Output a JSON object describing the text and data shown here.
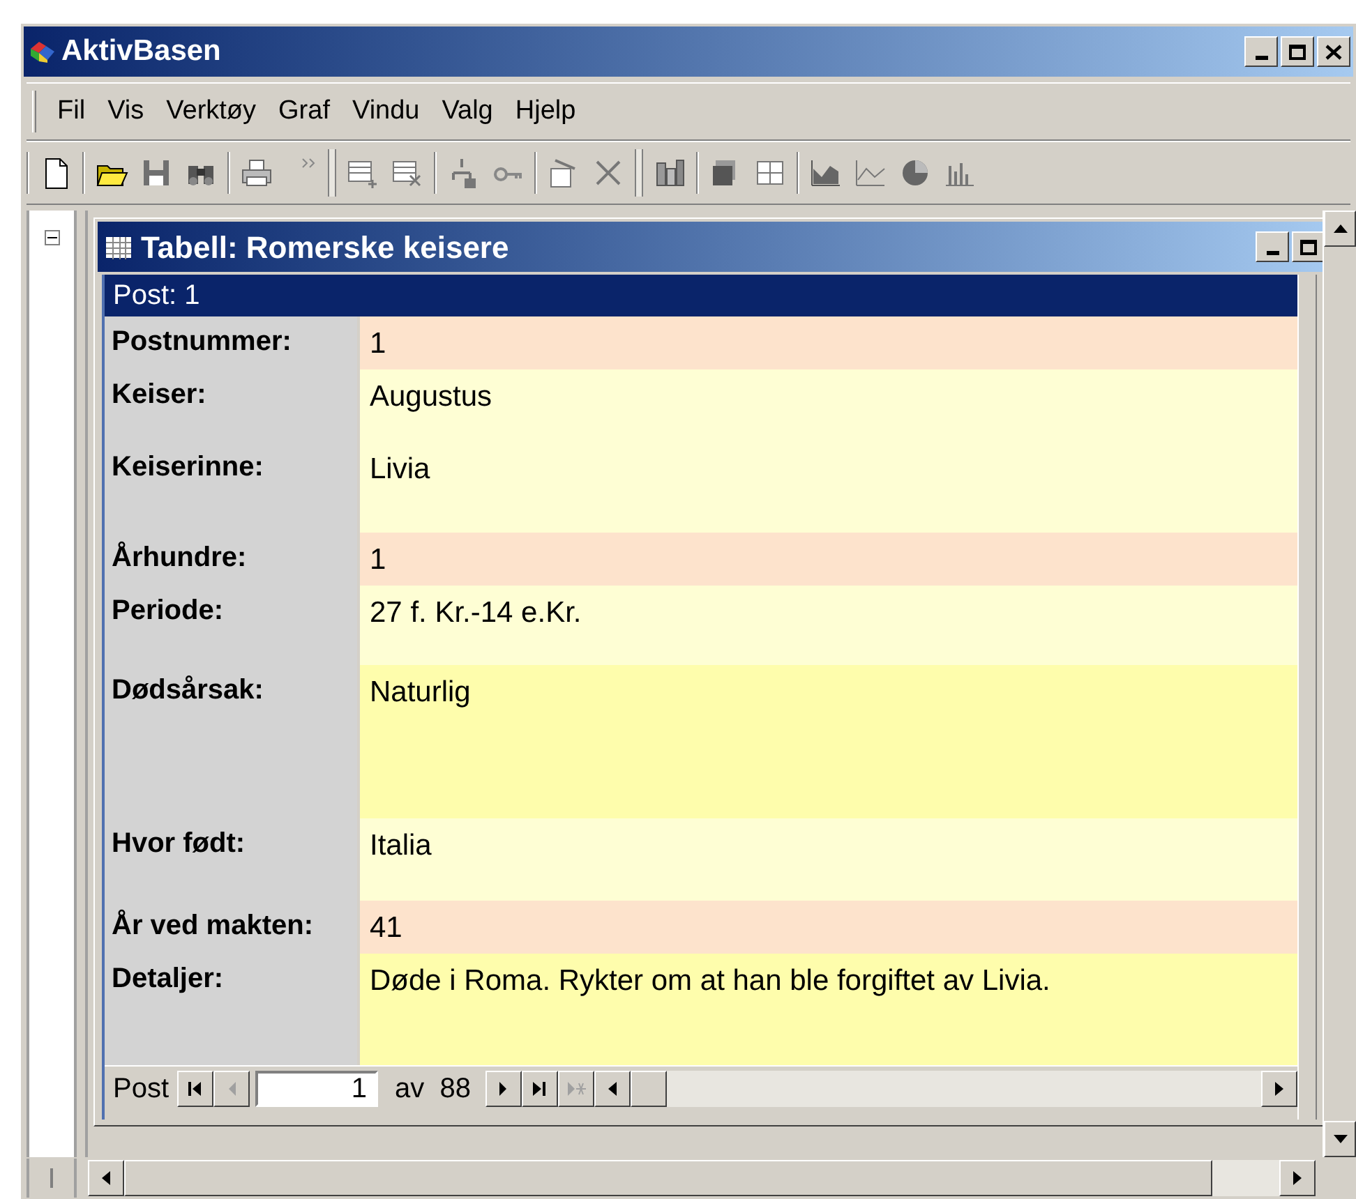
{
  "window": {
    "title": "AktivBasen"
  },
  "menu": [
    "Fil",
    "Vis",
    "Verktøy",
    "Graf",
    "Vindu",
    "Valg",
    "Hjelp"
  ],
  "child_window": {
    "title": "Tabell: Romerske keisere"
  },
  "record_header": "Post: 1",
  "fields": [
    {
      "label": "Postnummer:",
      "value": "1",
      "color": "#fde3cc"
    },
    {
      "label": "Keiser:",
      "value": "Augustus",
      "color": "#fefed4"
    },
    {
      "label": "Keiserinne:",
      "value": "Livia",
      "color": "#fefed4"
    },
    {
      "label": "Århundre:",
      "value": "1",
      "color": "#fde3cc"
    },
    {
      "label": "Periode:",
      "value": "27 f. Kr.-14 e.Kr.",
      "color": "#fefed4"
    },
    {
      "label": "Dødsårsak:",
      "value": "Naturlig",
      "color": "#fefdac"
    },
    {
      "label": "Hvor født:",
      "value": "Italia",
      "color": "#fefed4"
    },
    {
      "label": "År ved makten:",
      "value": "41",
      "color": "#fde3cc"
    },
    {
      "label": "Detaljer:",
      "value": "Døde i Roma. Rykter om at han ble forgiftet av Livia.",
      "color": "#fefdac"
    }
  ],
  "navigator": {
    "label": "Post",
    "value": "1",
    "total": "av  88",
    "buttons_before": [
      {
        "kind": "first",
        "disabled": false
      },
      {
        "kind": "prev",
        "disabled": true
      }
    ],
    "buttons_after": [
      {
        "kind": "next",
        "disabled": false
      },
      {
        "kind": "last",
        "disabled": false
      },
      {
        "kind": "new",
        "disabled": true
      }
    ]
  }
}
